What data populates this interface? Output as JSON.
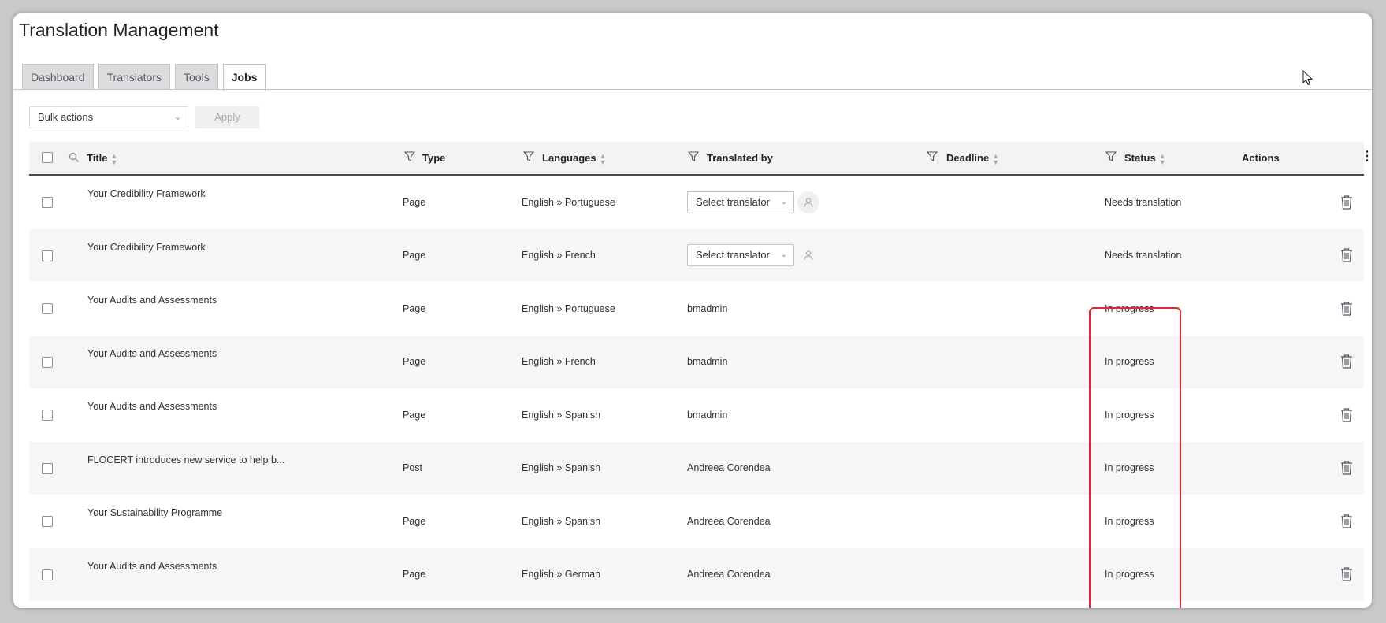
{
  "page_title": "Translation Management",
  "tabs": [
    {
      "label": "Dashboard",
      "active": false
    },
    {
      "label": "Translators",
      "active": false
    },
    {
      "label": "Tools",
      "active": false
    },
    {
      "label": "Jobs",
      "active": true
    }
  ],
  "bulk_actions": {
    "selected": "Bulk actions",
    "apply_label": "Apply"
  },
  "table": {
    "columns": {
      "title": "Title",
      "type": "Type",
      "languages": "Languages",
      "translated_by": "Translated by",
      "deadline": "Deadline",
      "status": "Status",
      "actions": "Actions"
    },
    "select_translator_label": "Select translator",
    "rows": [
      {
        "title": "Your Credibility Framework",
        "type": "Page",
        "languages": "English » Portuguese",
        "translated_by": "",
        "status": "Needs translation"
      },
      {
        "title": "Your Credibility Framework",
        "type": "Page",
        "languages": "English » French",
        "translated_by": "",
        "status": "Needs translation"
      },
      {
        "title": "Your Audits and Assessments",
        "type": "Page",
        "languages": "English » Portuguese",
        "translated_by": "bmadmin",
        "status": "In progress"
      },
      {
        "title": "Your Audits and Assessments",
        "type": "Page",
        "languages": "English » French",
        "translated_by": "bmadmin",
        "status": "In progress"
      },
      {
        "title": "Your Audits and Assessments",
        "type": "Page",
        "languages": "English » Spanish",
        "translated_by": "bmadmin",
        "status": "In progress"
      },
      {
        "title": "FLOCERT introduces new service to help b...",
        "type": "Post",
        "languages": "English » Spanish",
        "translated_by": "Andreea Corendea",
        "status": "In progress"
      },
      {
        "title": "Your Sustainability Programme",
        "type": "Page",
        "languages": "English » Spanish",
        "translated_by": "Andreea Corendea",
        "status": "In progress"
      },
      {
        "title": "Your Audits and Assessments",
        "type": "Page",
        "languages": "English » German",
        "translated_by": "Andreea Corendea",
        "status": "In progress"
      }
    ]
  },
  "colors": {
    "highlight": "#e8262a",
    "row_alt": "#f6f6f6",
    "header_bg": "#f3f3f3"
  }
}
